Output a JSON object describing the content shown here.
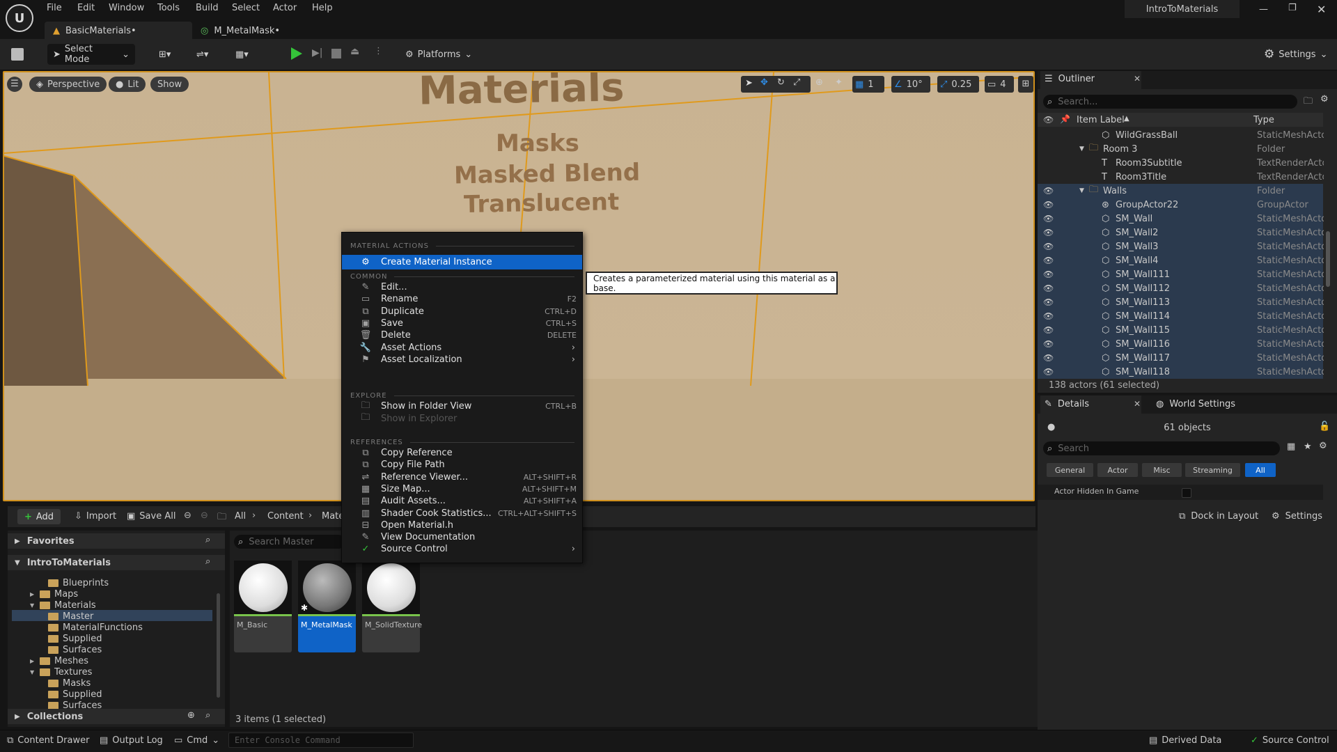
{
  "app": {
    "window_title": "IntroToMaterials"
  },
  "menu": [
    "File",
    "Edit",
    "Window",
    "Tools",
    "Build",
    "Select",
    "Actor",
    "Help"
  ],
  "doc_tabs": [
    {
      "label": "BasicMaterials•"
    },
    {
      "label": "M_MetalMask•"
    }
  ],
  "toolbar": {
    "select_mode": "Select Mode",
    "platforms": "Platforms",
    "settings": "Settings"
  },
  "viewport": {
    "perspective": "Perspective",
    "lit": "Lit",
    "show": "Show",
    "angle_snap": "10°",
    "scale_snap": "0.25",
    "grid_snap": "1",
    "camera_speed": "4",
    "scene_text": [
      "Materials",
      "Masks",
      "Masked Blend",
      "Translucent"
    ]
  },
  "context_menu": {
    "sections": {
      "material_actions": "MATERIAL ACTIONS",
      "common": "COMMON",
      "explore": "EXPLORE",
      "references": "REFERENCES"
    },
    "material_actions": [
      {
        "label": "Create Material Instance",
        "highlighted": true
      }
    ],
    "common": [
      {
        "label": "Edit...",
        "shortcut": ""
      },
      {
        "label": "Rename",
        "shortcut": "F2"
      },
      {
        "label": "Duplicate",
        "shortcut": "CTRL+D"
      },
      {
        "label": "Save",
        "shortcut": "CTRL+S"
      },
      {
        "label": "Delete",
        "shortcut": "DELETE"
      },
      {
        "label": "Asset Actions",
        "submenu": true
      },
      {
        "label": "Asset Localization",
        "submenu": true
      }
    ],
    "explore": [
      {
        "label": "Show in Folder View",
        "shortcut": "CTRL+B"
      },
      {
        "label": "Show in Explorer",
        "disabled": true
      }
    ],
    "references": [
      {
        "label": "Copy Reference",
        "shortcut": ""
      },
      {
        "label": "Copy File Path",
        "shortcut": ""
      },
      {
        "label": "Reference Viewer...",
        "shortcut": "ALT+SHIFT+R"
      },
      {
        "label": "Size Map...",
        "shortcut": "ALT+SHIFT+M"
      },
      {
        "label": "Audit Assets...",
        "shortcut": "ALT+SHIFT+A"
      },
      {
        "label": "Shader Cook Statistics...",
        "shortcut": "CTRL+ALT+SHIFT+S"
      },
      {
        "label": "Open Material.h",
        "shortcut": ""
      },
      {
        "label": "View Documentation",
        "shortcut": ""
      },
      {
        "label": "Source Control",
        "submenu": true
      }
    ],
    "tooltip": "Creates a parameterized material using this material as a base."
  },
  "outliner": {
    "tab": "Outliner",
    "search_placeholder": "Search...",
    "col_label": "Item Label",
    "col_type": "Type",
    "rows": [
      {
        "label": "WildGrassBall",
        "type": "StaticMeshActor",
        "indent": 2,
        "icon": "mesh",
        "sel": false
      },
      {
        "label": "Room 3",
        "type": "Folder",
        "indent": 1,
        "icon": "folder",
        "sel": false
      },
      {
        "label": "Room3Subtitle",
        "type": "TextRenderActor",
        "indent": 2,
        "icon": "text",
        "sel": false
      },
      {
        "label": "Room3Title",
        "type": "TextRenderActor",
        "indent": 2,
        "icon": "text",
        "sel": false
      },
      {
        "label": "Walls",
        "type": "Folder",
        "indent": 1,
        "icon": "folder",
        "sel": true
      },
      {
        "label": "GroupActor22",
        "type": "GroupActor",
        "indent": 2,
        "icon": "group",
        "sel": true
      },
      {
        "label": "SM_Wall",
        "type": "StaticMeshActor",
        "indent": 2,
        "icon": "mesh",
        "sel": true
      },
      {
        "label": "SM_Wall2",
        "type": "StaticMeshActor",
        "indent": 2,
        "icon": "mesh",
        "sel": true
      },
      {
        "label": "SM_Wall3",
        "type": "StaticMeshActor",
        "indent": 2,
        "icon": "mesh",
        "sel": true
      },
      {
        "label": "SM_Wall4",
        "type": "StaticMeshActor",
        "indent": 2,
        "icon": "mesh",
        "sel": true
      },
      {
        "label": "SM_Wall111",
        "type": "StaticMeshActor",
        "indent": 2,
        "icon": "mesh",
        "sel": true
      },
      {
        "label": "SM_Wall112",
        "type": "StaticMeshActor",
        "indent": 2,
        "icon": "mesh",
        "sel": true
      },
      {
        "label": "SM_Wall113",
        "type": "StaticMeshActor",
        "indent": 2,
        "icon": "mesh",
        "sel": true
      },
      {
        "label": "SM_Wall114",
        "type": "StaticMeshActor",
        "indent": 2,
        "icon": "mesh",
        "sel": true
      },
      {
        "label": "SM_Wall115",
        "type": "StaticMeshActor",
        "indent": 2,
        "icon": "mesh",
        "sel": true
      },
      {
        "label": "SM_Wall116",
        "type": "StaticMeshActor",
        "indent": 2,
        "icon": "mesh",
        "sel": true
      },
      {
        "label": "SM_Wall117",
        "type": "StaticMeshActor",
        "indent": 2,
        "icon": "mesh",
        "sel": true
      },
      {
        "label": "SM_Wall118",
        "type": "StaticMeshActor",
        "indent": 2,
        "icon": "mesh",
        "sel": true
      }
    ],
    "status": "138 actors (61 selected)"
  },
  "details": {
    "tab": "Details",
    "world_settings": "World Settings",
    "objects": "61 objects",
    "search_placeholder": "Search",
    "filters": [
      "General",
      "Actor",
      "Misc",
      "Streaming",
      "All"
    ],
    "property": "Actor Hidden In Game"
  },
  "content_browser": {
    "add": "Add",
    "import": "Import",
    "save_all": "Save All",
    "path": [
      "All",
      "Content",
      "Mate"
    ],
    "dock_in_layout": "Dock in Layout",
    "settings": "Settings",
    "favorites": "Favorites",
    "project": "IntroToMaterials",
    "collections": "Collections",
    "search_placeholder": "Search Master",
    "tree": [
      {
        "label": "Blueprints",
        "indent": 2,
        "sel": false,
        "arrow": ""
      },
      {
        "label": "Maps",
        "indent": 1,
        "sel": false,
        "arrow": "right"
      },
      {
        "label": "Materials",
        "indent": 1,
        "sel": false,
        "arrow": "down"
      },
      {
        "label": "Master",
        "indent": 2,
        "sel": true,
        "arrow": ""
      },
      {
        "label": "MaterialFunctions",
        "indent": 2,
        "sel": false,
        "arrow": ""
      },
      {
        "label": "Supplied",
        "indent": 2,
        "sel": false,
        "arrow": ""
      },
      {
        "label": "Surfaces",
        "indent": 2,
        "sel": false,
        "arrow": ""
      },
      {
        "label": "Meshes",
        "indent": 1,
        "sel": false,
        "arrow": "right"
      },
      {
        "label": "Textures",
        "indent": 1,
        "sel": false,
        "arrow": "down"
      },
      {
        "label": "Masks",
        "indent": 2,
        "sel": false,
        "arrow": ""
      },
      {
        "label": "Supplied",
        "indent": 2,
        "sel": false,
        "arrow": ""
      },
      {
        "label": "Surfaces",
        "indent": 2,
        "sel": false,
        "arrow": ""
      }
    ],
    "assets": [
      {
        "name": "M_Basic",
        "selected": false
      },
      {
        "name": "M_MetalMask",
        "selected": true
      },
      {
        "name": "M_SolidTexture",
        "selected": false
      }
    ],
    "status": "3 items (1 selected)"
  },
  "statusbar": {
    "content_drawer": "Content Drawer",
    "output_log": "Output Log",
    "cmd": "Cmd",
    "console_placeholder": "Enter Console Command",
    "derived_data": "Derived Data",
    "source_control": "Source Control"
  },
  "colors": {
    "accent": "#0f63c7",
    "selection_border": "#d0901c",
    "play_green": "#35c43a",
    "asset_bar": "#79c44b"
  }
}
